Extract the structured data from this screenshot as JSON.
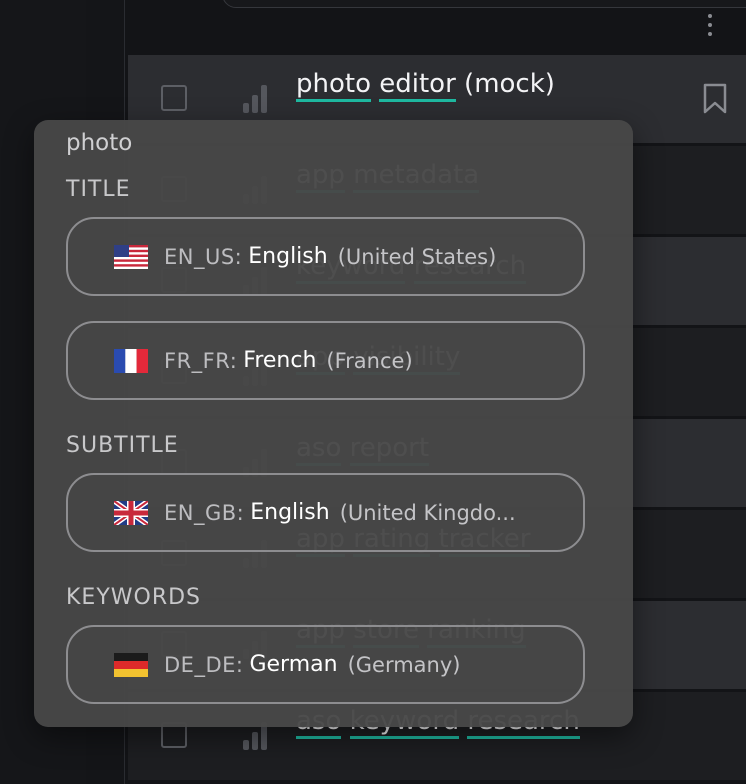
{
  "colors": {
    "accent_underline": "#1fb9a1",
    "popover_bg": "#484848",
    "row_highlight": "#2c2d31",
    "page_bg": "#131417"
  },
  "results": {
    "rows": [
      {
        "words": [
          "photo",
          "editor"
        ],
        "suffix": " (mock)"
      },
      {
        "words": [
          "app",
          "metadata"
        ],
        "suffix": ""
      },
      {
        "words": [
          "keyword",
          "research"
        ],
        "suffix": ""
      },
      {
        "words": [
          "app",
          "visibility"
        ],
        "suffix": ""
      },
      {
        "words": [
          "aso",
          "report"
        ],
        "suffix": ""
      },
      {
        "words": [
          "app",
          "rating",
          "tracker"
        ],
        "suffix": ""
      },
      {
        "words": [
          "app",
          "store",
          "ranking"
        ],
        "suffix": ""
      },
      {
        "words": [
          "aso",
          "keyword",
          "research"
        ],
        "suffix": ""
      }
    ]
  },
  "popover": {
    "term": "photo",
    "sections": {
      "title": "TITLE",
      "subtitle": "SUBTITLE",
      "keywords": "KEYWORDS"
    },
    "locales": [
      {
        "code": "EN_US:",
        "language": "English",
        "region": "(United States)",
        "flag": "us-flag-icon"
      },
      {
        "code": "FR_FR:",
        "language": "French",
        "region": "(France)",
        "flag": "fr-flag-icon"
      },
      {
        "code": "EN_GB:",
        "language": "English",
        "region": "(United Kingdo...",
        "flag": "gb-flag-icon"
      },
      {
        "code": "DE_DE:",
        "language": "German",
        "region": "(Germany)",
        "flag": "de-flag-icon"
      }
    ]
  }
}
